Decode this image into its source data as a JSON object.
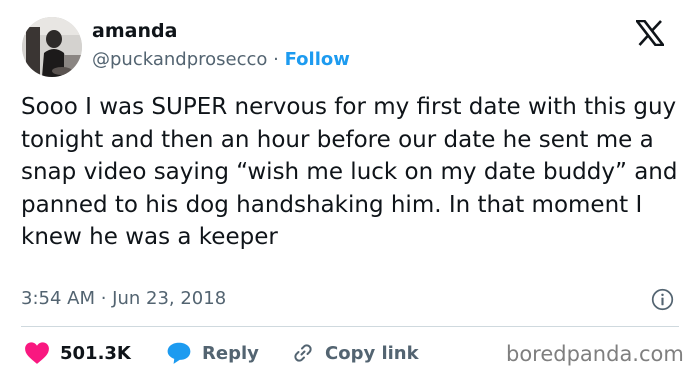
{
  "user": {
    "name": "amanda",
    "handle": "@puckandprosecco",
    "separator": "·",
    "follow_label": "Follow"
  },
  "tweet": {
    "text": "Sooo I was SUPER nervous for my first date with this guy tonight and then an hour before our date he sent me a snap video saying “wish me luck on my date buddy” and panned to his dog handshaking him. In that moment I knew he was a keeper",
    "timestamp": "3:54 AM · Jun 23, 2018"
  },
  "actions": {
    "likes_count": "501.3K",
    "reply_label": "Reply",
    "copy_link_label": "Copy link"
  },
  "icons": {
    "logo": "x-logo-icon",
    "info": "info-icon",
    "like": "heart-icon",
    "reply": "speech-bubble-icon",
    "copy": "link-icon"
  },
  "colors": {
    "follow": "#1d9bf0",
    "heart": "#f91880",
    "reply_bubble": "#1d9bf0",
    "secondary_text": "#536471"
  },
  "watermark": "boredpanda.com"
}
